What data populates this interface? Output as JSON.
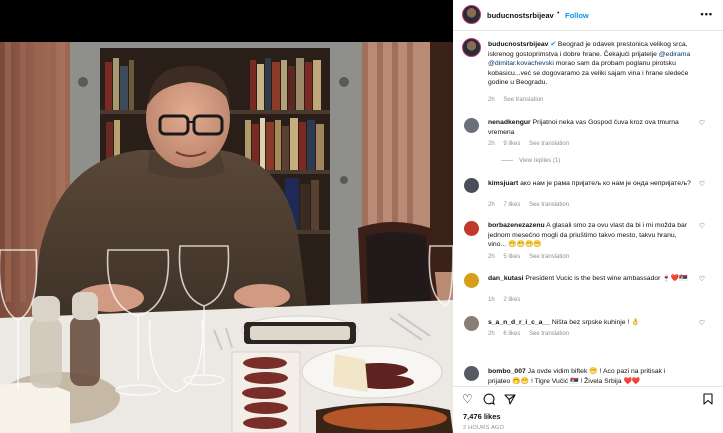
{
  "post": {
    "username": "buducnostsrbijeav",
    "follow_label": "Follow",
    "more_icon": "more-horizontal-icon",
    "caption_text": "Beograd je odavek prestonica velikog srca, iskrenog gostoprimstva i dobre hrane. Čekajući prijatelje",
    "caption_mention1": "@edirama",
    "caption_mention2": "@dimitar.kovachevski",
    "caption_text2": "morao sam da probam poglanu pirotsku kobasicu...već se dogovaramo za veliki sajam vina i hrane sledeće godine u Beogradu.",
    "caption_time": "2h",
    "see_translation": "See translation"
  },
  "comments": [
    {
      "username": "nenadkengur",
      "text": "Prijatnoi neka vas Gospod čuva kroz ova tmurna vremena",
      "time": "2h",
      "likes": "9 likes",
      "translation": "See translation",
      "view_replies": "View replies (1)",
      "avatar_color": "#6b6f7a"
    },
    {
      "username": "kimsjuart",
      "text": "ако нам је рама пријатељ ко нам је онда непријатељ?",
      "time": "2h",
      "likes": "7 likes",
      "translation": "See translation",
      "avatar_color": "#4a4e58"
    },
    {
      "username": "borbazenezazenu",
      "text": "A glasali smo za ovu vlast da bi i mi možda bar jednom mesečno mogli da priuštimo takvo mesto, takvu hranu, vino...",
      "emojis": "😁😁😁😁",
      "time": "2h",
      "likes": "5 likes",
      "translation": "See translation",
      "avatar_color": "#c0392b"
    },
    {
      "username": "dan_kutasi",
      "text": "President Vucic is the best wine ambassador",
      "emojis": "🍷❤️🇷🇸",
      "time": "1h",
      "likes": "2 likes",
      "avatar_color": "#d4a017"
    },
    {
      "username": "s_a_n_d_r_i_c_a__",
      "text": "Ništa bez srpske kuhinje !",
      "emojis": "👌",
      "time": "2h",
      "likes": "6 likes",
      "translation": "See translation",
      "avatar_color": "#8a7d74"
    },
    {
      "username": "bombo_007",
      "text": "Ja ovde vidim biftek 😁 ! Aco pazi na pritisak i",
      "text2": "prijateo 🤭😁 ! Tigre Vučić 🇷🇸 ! Živela Srbija ❤️❤️",
      "avatar_color": "#555a63"
    }
  ],
  "actions": {
    "like_icon": "heart-icon",
    "comment_icon": "comment-icon",
    "share_icon": "share-icon",
    "save_icon": "bookmark-icon"
  },
  "likes_count": "7,476 likes",
  "date_label": "2 HOURS AGO"
}
